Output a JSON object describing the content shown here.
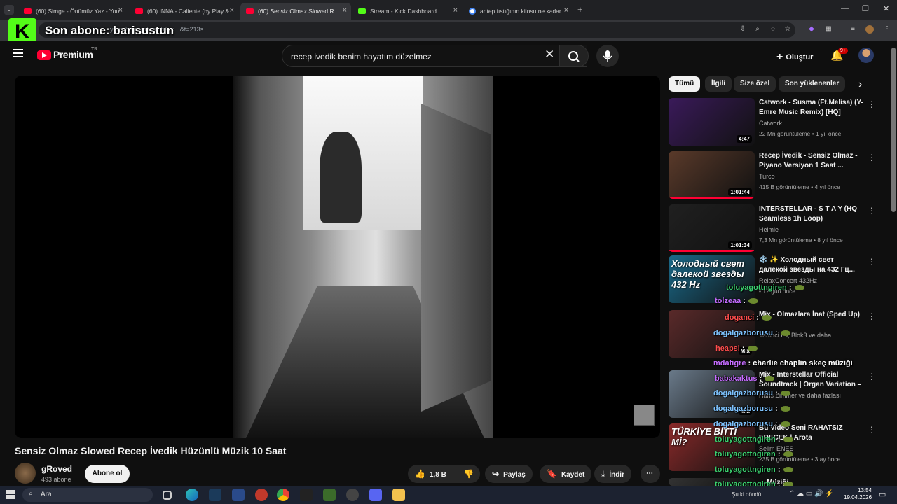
{
  "browser": {
    "tabs": [
      {
        "title": "(60) Simge - Önümüz Yaz - You",
        "icon": "youtube-icon"
      },
      {
        "title": "(60) INNA - Caliente (by Play &",
        "icon": "youtube-icon"
      },
      {
        "title": "(60) Sensiz Olmaz Slowed R",
        "icon": "youtube-icon"
      },
      {
        "title": "Stream - Kick Dashboard",
        "icon": "kick-icon"
      },
      {
        "title": "antep fıstığının kilosu ne kadar",
        "icon": "google-icon"
      }
    ],
    "new_tab": "+",
    "url": "youtube.com/watch?v=...&t=213s"
  },
  "kick_overlay": {
    "logo": "K",
    "last_subscriber": "Son abone: barisustun"
  },
  "yt_header": {
    "logo": "Premium",
    "region": "TR",
    "search_value": "recep ivedik benim hayatım düzelmez",
    "create_label": "Oluştur",
    "notif_badge": "9+"
  },
  "video": {
    "title": "Sensiz Olmaz Slowed Recep İvedik Hüzünlü Müzik 10 Saat",
    "channel": "gRoved",
    "subscribers": "493 abone",
    "subscribe_label": "Abone ol",
    "likes": "1,8 B",
    "share_label": "Paylaş",
    "save_label": "Kaydet",
    "download_label": "İndir"
  },
  "chips": [
    "Tümü",
    "İlgili",
    "Size özel",
    "Son yüklenenler"
  ],
  "recommendations": [
    {
      "title": "Catwork - Susma (Ft.Melisa) (Y-Emre Music Remix) [HQ]",
      "channel": "Catwork",
      "meta": "22 Mn görüntüleme • 1 yıl önce",
      "duration": "4:47",
      "progress": 0.0,
      "thumb_color": "#3a1a5a"
    },
    {
      "title": "Recep İvedik - Sensiz Olmaz - Piyano Versiyon 1 Saat ...",
      "channel": "Turco",
      "meta": "415 B görüntüleme • 4 yıl önce",
      "duration": "1:01:44",
      "progress": 1.0,
      "thumb_color": "#5a3a2a"
    },
    {
      "title": "INTERSTELLAR - S T A Y (HQ Seamless 1h Loop)",
      "channel": "Helmie",
      "meta": "7,3 Mn görüntüleme • 8 yıl önce",
      "duration": "1:01:34",
      "progress": 1.0,
      "thumb_color": "#202020"
    },
    {
      "title": "❄️ ✨ Холодный свет далёкой звезды на 432 Гц... который ...",
      "channel": "RelaxConcert 432Hz",
      "meta": "• 12 gün önce",
      "duration": "",
      "progress": 0.0,
      "thumb_color": "#1a6a8a",
      "thumb_text": "Холодный свет далекой звезды 432 Hz"
    },
    {
      "title": "Mix - Olmazlara İnat (Sped Up)",
      "channel": "Yedinci Ev, Blok3 ve daha ...",
      "meta": "",
      "duration": "Mix",
      "progress": 0.0,
      "thumb_color": "#5a2a2a"
    },
    {
      "title": "Mix - Interstellar Official Soundtrack | Organ Variation – ...",
      "channel": "Hans Zimmer ve daha fazlası",
      "meta": "",
      "duration": "Mix",
      "progress": 0.0,
      "thumb_color": "#6a7a8a"
    },
    {
      "title": "Bu Video Seni RAHATSIZ EDECEK | Arota",
      "channel": "Selim ENES",
      "meta": "235 B görüntüleme • 3 ay önce",
      "duration": "",
      "progress": 0.0,
      "thumb_color": "#8a2a2a",
      "thumb_text": "TÜRKİYE BİTTİ Mİ?"
    },
    {
      "title": "... Müziği",
      "channel": "",
      "meta": "",
      "duration": "",
      "progress": 0.0,
      "thumb_color": "#333333"
    }
  ],
  "chat": [
    {
      "user": "toluyagottngiren",
      "msg": ":",
      "color": "g"
    },
    {
      "user": "tolzeaa",
      "msg": ":",
      "color": "p"
    },
    {
      "user": "doganci",
      "msg": ":",
      "color": "r"
    },
    {
      "user": "dogalgazborusu",
      "msg": ":",
      "color": "b"
    },
    {
      "user": "heapsi",
      "msg": ":",
      "color": "r"
    },
    {
      "user": "mdatigre",
      "msg": ": charlie chaplin skeç müziği",
      "color": "p"
    },
    {
      "user": "babakaktus",
      "msg": ":",
      "color": "p"
    },
    {
      "user": "dogalgazborusu",
      "msg": ":",
      "color": "b"
    },
    {
      "user": "dogalgazborusu",
      "msg": ":",
      "color": "b"
    },
    {
      "user": "dogalgazborusu",
      "msg": ":",
      "color": "b"
    },
    {
      "user": "toluyagottngiren",
      "msg": ":",
      "color": "g"
    },
    {
      "user": "toluyagottngiren",
      "msg": ":",
      "color": "g"
    },
    {
      "user": "toluyagottngiren",
      "msg": ":",
      "color": "g"
    },
    {
      "user": "toluyagottngiren",
      "msg": ":",
      "color": "g"
    }
  ],
  "taskbar": {
    "search_placeholder": "Ara",
    "weather": "Şu ki döndü...",
    "time": "13:54",
    "date": "19.04.2026"
  }
}
